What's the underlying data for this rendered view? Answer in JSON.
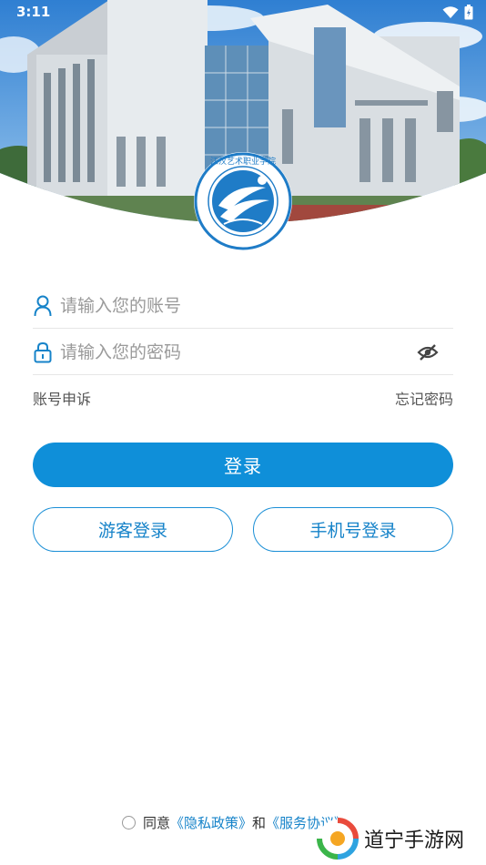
{
  "status_bar": {
    "time": "3:11"
  },
  "logo": {
    "caption": "JIANGHAN ART VOCATIONAL COLLEGE",
    "chinese": "江汉艺术职业学院"
  },
  "form": {
    "account_placeholder": "请输入您的账号",
    "password_placeholder": "请输入您的密码",
    "appeal_label": "账号申诉",
    "forgot_label": "忘记密码"
  },
  "buttons": {
    "login": "登录",
    "guest": "游客登录",
    "phone": "手机号登录"
  },
  "agreement": {
    "prefix": "同意",
    "privacy": "《隐私政策》",
    "and": "和",
    "service": "《服务协议》"
  },
  "watermark": {
    "text": "道宁手游网"
  },
  "colors": {
    "primary": "#0f8fd9",
    "link": "#1683c9"
  },
  "icons": [
    "user-icon",
    "lock-icon",
    "eye-off-icon",
    "wifi-icon",
    "battery-icon"
  ]
}
